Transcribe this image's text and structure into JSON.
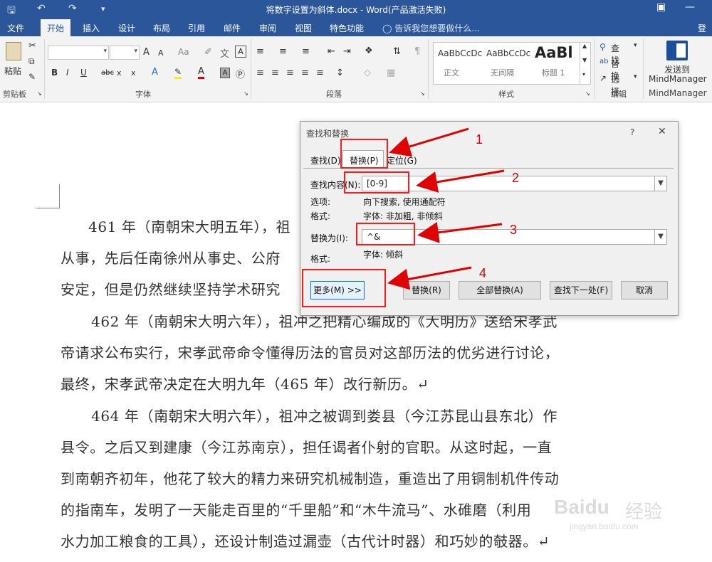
{
  "window": {
    "title": "将数字设置为斜体.docx - Word(产品激活失败)",
    "qa_icons": [
      "save-icon",
      "undo-icon",
      "redo-icon",
      "customize-icon"
    ],
    "login": "登录"
  },
  "ribbon_tabs": [
    "文件",
    "开始",
    "插入",
    "设计",
    "布局",
    "引用",
    "邮件",
    "审阅",
    "视图",
    "特色功能"
  ],
  "active_tab": "开始",
  "tell_me": "告诉我您想要做什么...",
  "ribbon": {
    "clipboard": {
      "paste": "粘贴",
      "label": "剪贴板"
    },
    "font": {
      "label": "字体",
      "row1": [
        "A",
        "A",
        "Aa",
        "A"
      ],
      "row2": [
        "B",
        "I",
        "U",
        "abc",
        "x",
        "x",
        "A",
        "A",
        "A",
        "A"
      ]
    },
    "paragraph": {
      "label": "段落"
    },
    "styles": {
      "label": "样式",
      "items": [
        {
          "sample": "AaBbCcDc",
          "name": "正文"
        },
        {
          "sample": "AaBbCcDc",
          "name": "无间隔"
        },
        {
          "sample": "AaBl",
          "name": "标题 1"
        }
      ]
    },
    "editing": {
      "find": "查找",
      "replace": "替换",
      "select": "选择",
      "label": "编辑"
    },
    "mindmanager": {
      "send_to": "发送到",
      "app": "MindManager",
      "label": "MindManager"
    }
  },
  "document": {
    "lines": [
      "461 年（南朝宋大明五年），祖",
      "从事，先后任南徐州从事史、公府",
      "安定，但是仍然继续坚持学术研究",
      "462 年（南朝宋大明六年），祖冲之把精心编成的《大明历》送给宋孝武",
      "帝请求公布实行，宋孝武帝命令懂得历法的官员对这部历法的优劣进行讨论，",
      "最终，宋孝武帝决定在大明九年（465 年）改行新历。↵",
      "464 年（南朝宋大明六年），祖冲之被调到娄县（今江苏昆山县东北）作",
      "县令。之后又到建康（今江苏南京），担任谒者仆射的官职。从这时起，一直",
      "到南朝齐初年，他花了较大的精力来研究机械制造，重造出了用铜制机件传动",
      "的指南车，发明了一天能走百里的“千里船”和“木牛流马”、水碓磨（利用",
      "水力加工粮食的工具），还设计制造过漏壶（古代计时器）和巧妙的攲器。↵"
    ]
  },
  "dialog": {
    "title": "查找和替换",
    "help": "?",
    "close": "✕",
    "tabs": [
      "查找(D)",
      "替换(P)",
      "定位(G)"
    ],
    "active_tab": "替换(P)",
    "find_label": "查找内容(N):",
    "find_value": "[0-9]",
    "options_label": "选项:",
    "options_value": "向下搜索, 使用通配符",
    "format_label": "格式:",
    "find_format": "字体: 非加粗, 非倾斜",
    "replace_label": "替换为(I):",
    "replace_value": "^&",
    "replace_format_label": "格式:",
    "replace_format": "字体: 倾斜",
    "buttons": {
      "more": "更多(M) >>",
      "replace": "替换(R)",
      "replace_all": "全部替换(A)",
      "find_next": "查找下一处(F)",
      "cancel": "取消"
    }
  },
  "annotations": [
    "1",
    "2",
    "3",
    "4"
  ],
  "annotation_color": "#ff1a1a",
  "watermark": {
    "brand": "Baidu",
    "cn": "经验",
    "url": "jingyan.baidu.com"
  }
}
